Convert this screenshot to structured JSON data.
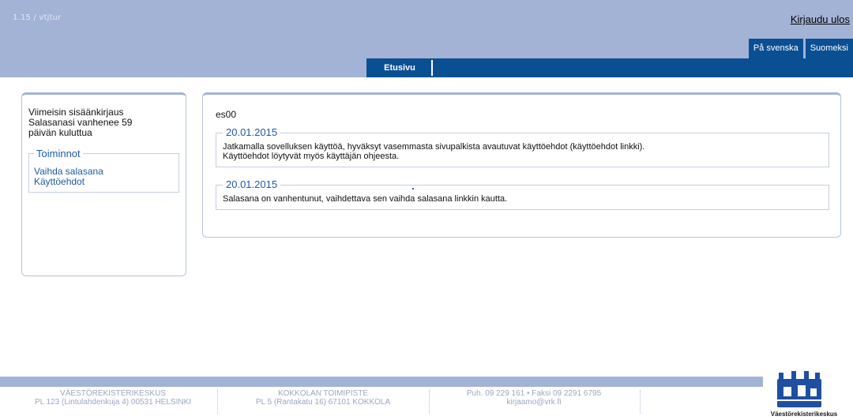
{
  "header": {
    "version": "1.15 / vtjtur",
    "logout_label": "Kirjaudu ulos",
    "lang_tabs": [
      "På svenska",
      "Suomeksi"
    ],
    "nav_tab": "Etusivu"
  },
  "sidebar": {
    "lines": [
      "Viimeisin sisäänkirjaus",
      "Salasanasi vanhenee 59",
      "päivän kuluttua"
    ],
    "actions_title": "Toiminnot",
    "links": [
      "Vaihda salasana",
      "Käyttöehdot"
    ]
  },
  "main": {
    "username": "es00",
    "messages": [
      {
        "date": "20.01.2015",
        "lines": [
          "Jatkamalla sovelluksen käyttöä, hyväksyt vasemmasta sivupalkista avautuvat käyttöehdot (käyttöehdot linkki).",
          "Käyttöehdot löytyvät myös käyttäjän ohjeesta."
        ]
      },
      {
        "date": "20.01.2015",
        "lines": [
          "Salasana on vanhentunut, vaihdettava sen vaihda salasana linkkin kautta."
        ]
      }
    ]
  },
  "footer": {
    "columns": [
      {
        "line1": "VÄESTÖREKISTERIKESKUS",
        "line2": "PL 123 (Lintulahdenkuja 4) 00531 HELSINKI"
      },
      {
        "line1": "KOKKOLAN TOIMIPISTE",
        "line2": "PL 5 (Rantakatu 16) 67101 KOKKOLA"
      },
      {
        "line1": "Puh. 09 229 161 • Faksi 09 2291 6795",
        "line2": "kirjaamo@vrk.fi"
      }
    ],
    "logo_text": "Väestörekisterikeskus"
  },
  "colors": {
    "header_bg": "#a3b3d5",
    "nav_bg": "#0b4f93",
    "link": "#1f5aa8"
  }
}
